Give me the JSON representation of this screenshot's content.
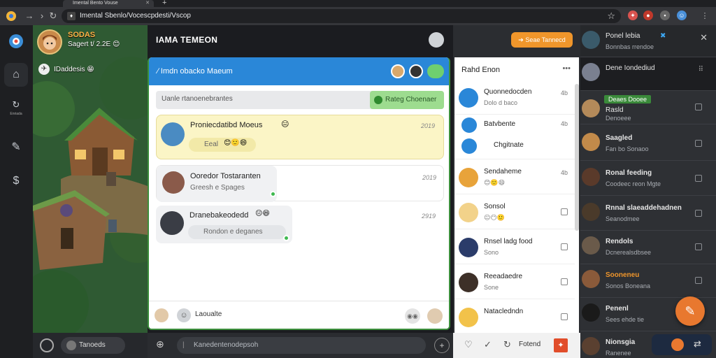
{
  "browser": {
    "tab_title": "Imental Bento Vouse",
    "url": "Imental Sbenlo/Vocescpdesti/Vscop",
    "icons": [
      "back-icon",
      "forward-icon",
      "reload-icon",
      "lock-icon",
      "star-icon",
      "extension-icon",
      "profile-icon",
      "menu-icon"
    ]
  },
  "rail": {
    "items": [
      {
        "name": "home",
        "label": ""
      },
      {
        "name": "game",
        "label": ""
      },
      {
        "name": "sync",
        "label": "Enriada"
      },
      {
        "name": "edit",
        "label": ""
      },
      {
        "name": "coin",
        "label": ""
      }
    ]
  },
  "scene": {
    "profile_name": "SODAS",
    "profile_status": "Sagert t/ 2.2E",
    "label": "IDaddesis",
    "bottom_label": "Tanoeds"
  },
  "chat": {
    "title": "IAMA TEMEON",
    "header": "∕ Imdn obacko Maeum",
    "search_placeholder": "Uanle rtanoenebrantes",
    "search_button": "Rateg Choenaer",
    "messages": [
      {
        "title": "Proniecdatibd Moeus",
        "sub": "Eeal",
        "time": "2019"
      },
      {
        "title": "Ooredor Tostaranten",
        "sub": "Greesh e Spages",
        "time": "2019"
      },
      {
        "title": "Dranebakeodedd",
        "sub": "Rondon e deganes",
        "time": "2919"
      }
    ],
    "input_label": "Laoualte"
  },
  "inputbar": {
    "placeholder": "Kanedentenodepsoh"
  },
  "friends": {
    "button": "Seae Tannecd",
    "title": "Rahd Enon",
    "rows": [
      {
        "name": "Quonnedocden",
        "sub": "Dolo d baco",
        "time": "4b"
      },
      {
        "name": "Batvbente",
        "sub": "",
        "time": "4b"
      },
      {
        "name": "Chgitnate",
        "sub": "",
        "time": ""
      },
      {
        "name": "Sendaheme",
        "sub": "",
        "time": "4b"
      },
      {
        "name": "Sonsol",
        "sub": "",
        "time": ""
      },
      {
        "name": "Rnsel ladg food",
        "sub": "Sono",
        "time": ""
      },
      {
        "name": "Reeadaedre",
        "sub": "Sone",
        "time": ""
      },
      {
        "name": "Natacledndn",
        "sub": "",
        "time": ""
      }
    ],
    "bottom": "Fotend"
  },
  "dark_list": {
    "title": "Ponel lebia",
    "subtitle": "Bonnbas rrendoe",
    "rows": [
      {
        "name": "Dene Iondediud",
        "sub": "",
        "badge": ""
      },
      {
        "name": "Rasld",
        "sub": "Denoeee",
        "badge": "Deaes Dooee"
      },
      {
        "name": "Saagled",
        "sub": "Fan bo Sonaoo",
        "badge": ""
      },
      {
        "name": "Ronal feeding",
        "sub": "Coodeec reon Mgte",
        "badge": ""
      },
      {
        "name": "Rnnal slaeaddehadnen",
        "sub": "Seanodmee",
        "badge": ""
      },
      {
        "name": "Rendols",
        "sub": "Dcnerealsdbsee",
        "badge": ""
      },
      {
        "name": "Sooneneu",
        "sub": "Sonos Boneana",
        "badge": ""
      },
      {
        "name": "Penenl",
        "sub": "Sees ehde tie",
        "badge": ""
      },
      {
        "name": "Nionsgia",
        "sub": "Ranenee",
        "badge": ""
      }
    ]
  },
  "colors": {
    "accent": "#2a87d8",
    "orange": "#f0962b",
    "online": "#3fb950"
  }
}
